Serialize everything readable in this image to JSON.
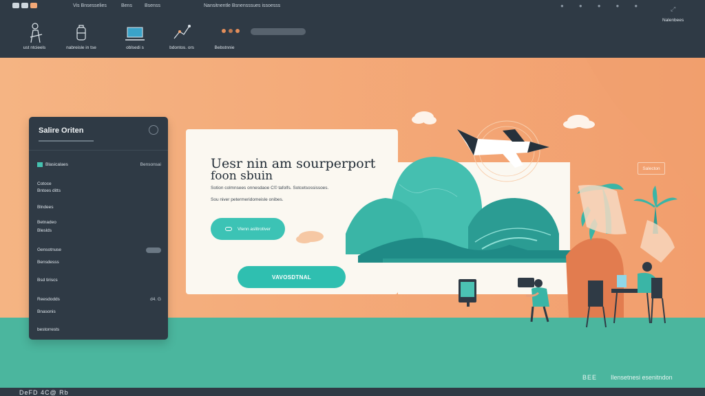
{
  "topbar": {
    "links": [
      "Vis Bnsesselies",
      "Bens",
      "Bsenss",
      "Nansitnentle Bsnensssues issoesss"
    ],
    "nav": [
      {
        "icon": "person-icon",
        "label": "ust ntcieels"
      },
      {
        "icon": "briefcase-icon",
        "label": "nabreisle in tse"
      },
      {
        "icon": "laptop-icon",
        "label": "oblsedi s"
      },
      {
        "icon": "chart-icon",
        "label": "bdontos. ors"
      },
      {
        "icon": "none",
        "label": "Bebstnnie"
      }
    ],
    "account": "Nalenbees"
  },
  "sidebar": {
    "title": "Salire Oriten",
    "items": [
      {
        "label": "Blasicalaes",
        "value": "Bensonsai"
      },
      {
        "label": "Cotoce",
        "value": ""
      },
      {
        "label": "Bntoes ditts",
        "value": ""
      },
      {
        "label": "Blndees",
        "value": ""
      },
      {
        "label": "Betnadeo",
        "value": ""
      },
      {
        "label": "Bleslds",
        "value": ""
      },
      {
        "label": "Gensotnuse",
        "value": ""
      },
      {
        "label": "Bensdesss",
        "value": ""
      },
      {
        "label": "Bsd tiriscs",
        "value": ""
      },
      {
        "label": "Reesdodds",
        "value": "d4. G"
      },
      {
        "label": "Bnasonis",
        "value": ""
      },
      {
        "label": "bestorrests",
        "value": ""
      }
    ]
  },
  "hero": {
    "title_line1": "Uesr nin am sourperport",
    "title_line2": "foon sbuin",
    "line1": "Sotion colmnsees onnesdaoe C© tafolfs. Sotcetsossissoes.",
    "line2": "Sou niver petermeridomeisle onibes.",
    "btn_small": "Vlenn aslitrotiver",
    "btn_main": "VAVOSDTNAL"
  },
  "right_tag": "Salecton",
  "footer": {
    "brand_mark": "BEE",
    "brand_text": "Ilensetnesi esenitndon",
    "bottom_label": "DeFD 4C@ Rb"
  },
  "colors": {
    "topbar": "#2f3a45",
    "background": "#f3a877",
    "accent": "#3cc3b5",
    "floor": "#4bb69e",
    "card": "#fbf8f1"
  }
}
